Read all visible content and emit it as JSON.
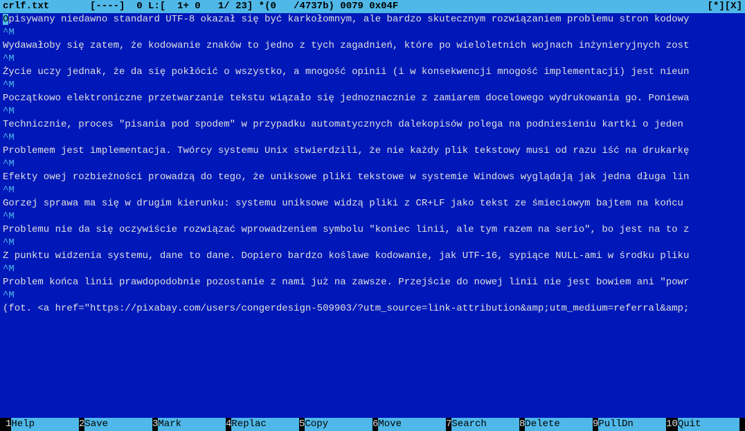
{
  "titlebar": {
    "filename": "crlf.txt",
    "status": "[----]  0 L:[  1+ 0   1/ 23] *(0   /4737b) 0079 0x04F",
    "right": "[*][X]"
  },
  "lines": [
    "Opisywany niedawno standard UTF-8 okazał się być karkołomnym, ale bardzo skutecznym rozwiązaniem problemu stron kodowy",
    "^M",
    "Wydawałoby się zatem, że kodowanie znaków to jedno z tych zagadnień, które po wieloletnich wojnach inżynieryjnych zost",
    "^M",
    "Życie uczy jednak, że da się pokłócić o wszystko, a mnogość opinii (i w konsekwencji mnogość implementacji) jest nieun",
    "^M",
    "Początkowo elektroniczne przetwarzanie tekstu wiązało się jednoznacznie z zamiarem docelowego wydrukowania go. Poniewa",
    "^M",
    "Technicznie, proces \"pisania pod spodem\" w przypadku automatycznych dalekopisów polega na podniesieniu kartki o jeden ",
    "^M",
    "Problemem jest implementacja. Twórcy systemu Unix stwierdzili, że nie każdy plik tekstowy musi od razu iść na drukarkę",
    "^M",
    "Efekty owej rozbieżności prowadzą do tego, że uniksowe pliki tekstowe w systemie Windows wyglądają jak jedna długa lin",
    "^M",
    "Gorzej sprawa ma się w drugim kierunku: systemu uniksowe widzą pliki z CR+LF jako tekst ze śmieciowym bajtem na końcu ",
    "^M",
    "Problemu nie da się oczywiście rozwiązać wprowadzeniem symbolu \"koniec linii, ale tym razem na serio\", bo jest na to z",
    "^M",
    "Z punktu widzenia systemu, dane to dane. Dopiero bardzo koślawe kodowanie, jak UTF-16, sypiące NULL-ami w środku pliku",
    "^M",
    "Problem końca linii prawdopodobnie pozostanie z nami już na zawsze. Przejście do nowej linii nie jest bowiem ani \"powr",
    "^M",
    "(fot. <a href=\"https://pixabay.com/users/congerdesign-509903/?utm_source=link-attribution&amp;utm_medium=referral&amp;"
  ],
  "menu": [
    {
      "num": "1",
      "label": "Help"
    },
    {
      "num": "2",
      "label": "Save"
    },
    {
      "num": "3",
      "label": "Mark"
    },
    {
      "num": "4",
      "label": "Replac"
    },
    {
      "num": "5",
      "label": "Copy"
    },
    {
      "num": "6",
      "label": "Move"
    },
    {
      "num": "7",
      "label": "Search"
    },
    {
      "num": "8",
      "label": "Delete"
    },
    {
      "num": "9",
      "label": "PullDn"
    },
    {
      "num": "10",
      "label": "Quit"
    }
  ]
}
